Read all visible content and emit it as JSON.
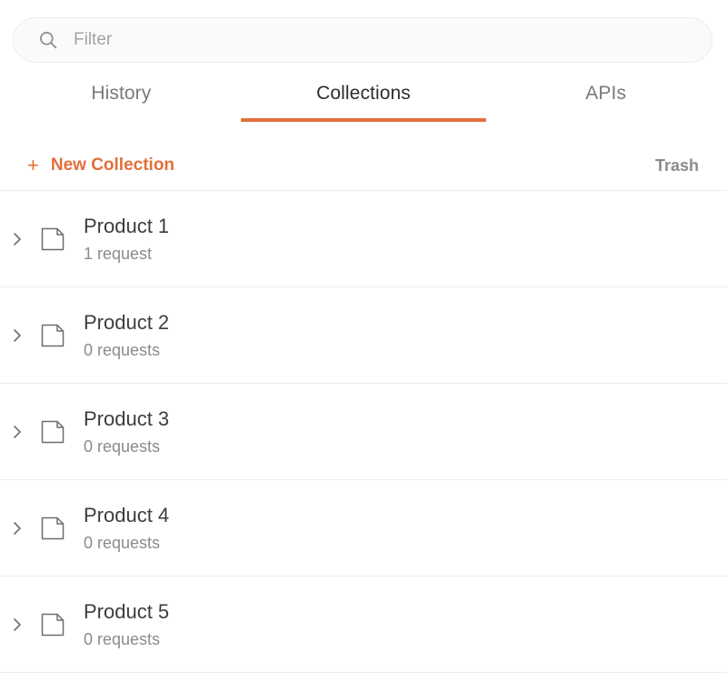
{
  "search": {
    "icon": "search-icon",
    "value": "",
    "placeholder": "Filter"
  },
  "tabs": [
    {
      "id": "history",
      "label": "History",
      "active": false
    },
    {
      "id": "collections",
      "label": "Collections",
      "active": true
    },
    {
      "id": "apis",
      "label": "APIs",
      "active": false
    }
  ],
  "toolbar": {
    "new_collection_icon": "plus-icon",
    "new_collection_label": "New Collection",
    "trash_label": "Trash"
  },
  "collections": [
    {
      "chevron_icon": "chevron-right-icon",
      "folder_icon": "folder-icon",
      "title": "Product 1",
      "requests": "1 request"
    },
    {
      "chevron_icon": "chevron-right-icon",
      "folder_icon": "folder-icon",
      "title": "Product 2",
      "requests": "0 requests"
    },
    {
      "chevron_icon": "chevron-right-icon",
      "folder_icon": "folder-icon",
      "title": "Product 3",
      "requests": "0 requests"
    },
    {
      "chevron_icon": "chevron-right-icon",
      "folder_icon": "folder-icon",
      "title": "Product 4",
      "requests": "0 requests"
    },
    {
      "chevron_icon": "chevron-right-icon",
      "folder_icon": "folder-icon",
      "title": "Product 5",
      "requests": "0 requests"
    }
  ],
  "colors": {
    "accent": "#e1703a",
    "title_text": "#3d3d3f",
    "muted_text": "#8b8b8e",
    "separator": "#ececed",
    "search_bg": "#fafafa",
    "background": "#ffffff"
  }
}
